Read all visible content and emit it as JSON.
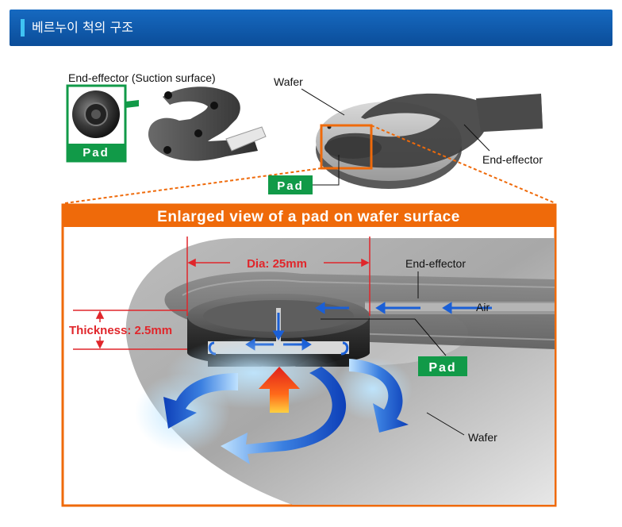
{
  "header": {
    "title": "베르누이 척의 구조"
  },
  "top": {
    "suction_label": "End-effector (Suction surface)",
    "wafer_label": "Wafer",
    "end_effector_label": "End-effector",
    "pad_badge_left": "Pad",
    "pad_badge_right": "Pad"
  },
  "enlarged": {
    "title": "Enlarged view of a pad on wafer surface",
    "dia": "Dia: 25mm",
    "thickness": "Thickness: 2.5mm",
    "end_effector": "End-effector",
    "air": "Air",
    "pad": "Pad",
    "wafer": "Wafer"
  },
  "colors": {
    "header_blue": "#0f5bac",
    "accent_orange": "#ef6a0a",
    "pad_green": "#119a48",
    "dimension_red": "#e0262b",
    "flow_blue": "#1a5fd6"
  }
}
